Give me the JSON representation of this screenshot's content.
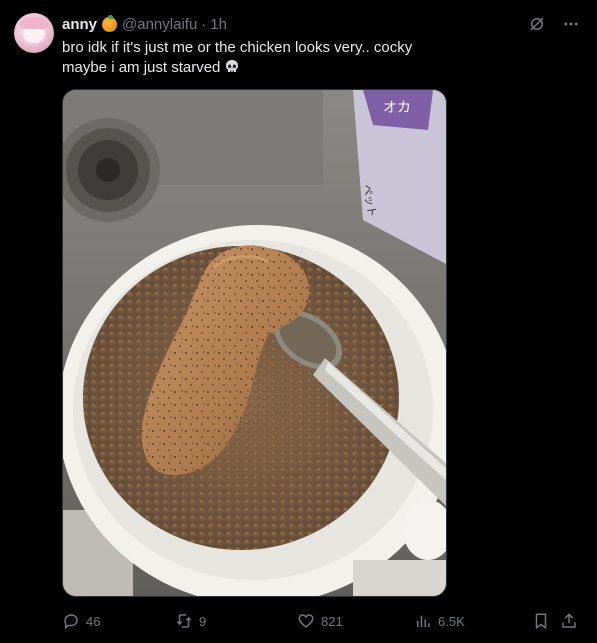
{
  "tweet": {
    "author": {
      "name": "anny",
      "handle": "@annylaifu",
      "separator": "·",
      "time": "1h"
    },
    "text_line1": "bro idk if it's just me or the chicken looks very.. cocky",
    "text_line2": "maybe i am just starved",
    "emoji": "skull-emoji",
    "media": {
      "package_text": "オカ",
      "package_text_2": "ペット"
    },
    "stats": {
      "replies": "46",
      "reposts": "9",
      "likes": "821",
      "views": "6.5K"
    }
  },
  "icons": [
    "avatar",
    "orange-badge-icon",
    "grok-icon",
    "more-icon",
    "reply-icon",
    "repost-icon",
    "like-icon",
    "views-icon",
    "bookmark-icon",
    "share-icon"
  ],
  "colors": {
    "background": "#000000",
    "text": "#e7e9ea",
    "muted": "#71767b"
  }
}
